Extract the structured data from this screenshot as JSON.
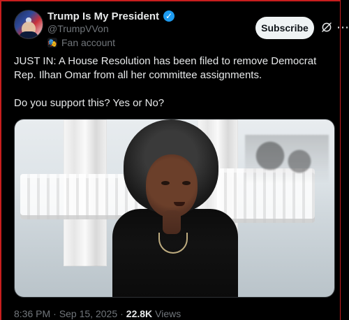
{
  "account": {
    "name": "Trump Is My President",
    "handle": "@TrumpVVon",
    "fan_label": "Fan account",
    "verified": true
  },
  "actions": {
    "subscribe_label": "Subscribe",
    "grok_icon": "grok-icon",
    "more_icon": "more-icon"
  },
  "post": {
    "text": "JUST IN: A House Resolution has been filed to remove Democrat Rep. Ilhan Omar from all her committee assignments.\n\nDo you support this? Yes or No?"
  },
  "meta": {
    "time": "8:36 PM",
    "sep1": "·",
    "date": "Sep 15, 2025",
    "sep2": "·",
    "views": "22.8K",
    "views_label": "Views"
  },
  "colors": {
    "background": "#000000",
    "text": "#e7e9ea",
    "subtle": "#71767b",
    "accent_blue": "#1d9bf0",
    "button_bg": "#eff3f4",
    "button_text": "#0f1419",
    "frame_red": "#c81d1d"
  }
}
